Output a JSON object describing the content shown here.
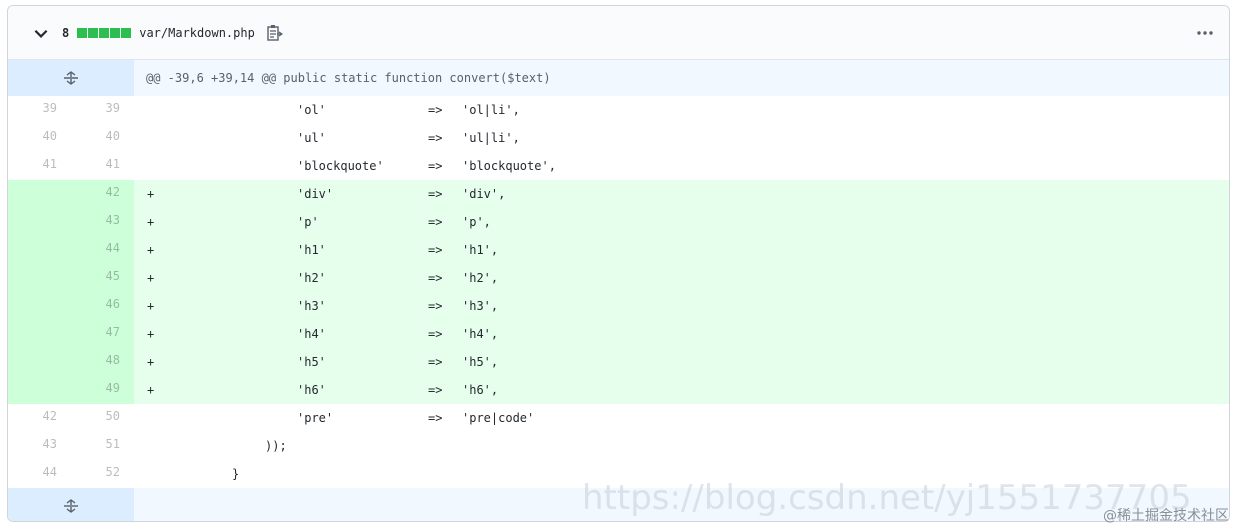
{
  "file": {
    "changes": "8",
    "path": "var/Markdown.php",
    "diffstat_color": "#2cbe4e",
    "icons": {
      "collapse": "chevron-down-icon",
      "copy": "copy-icon",
      "more": "kebab-horizontal-icon",
      "expand": "unfold-icon"
    }
  },
  "hunk": {
    "header": "@@ -39,6 +39,14 @@ public static function convert($text)"
  },
  "lines": [
    {
      "type": "context",
      "old": "39",
      "new": "39",
      "sign": "",
      "c1": "'ol'",
      "c2": "=>",
      "c3": "'ol|li',"
    },
    {
      "type": "context",
      "old": "40",
      "new": "40",
      "sign": "",
      "c1": "'ul'",
      "c2": "=>",
      "c3": "'ul|li',"
    },
    {
      "type": "context",
      "old": "41",
      "new": "41",
      "sign": "",
      "c1": "'blockquote'",
      "c2": "=>",
      "c3": "'blockquote',"
    },
    {
      "type": "addition",
      "old": "",
      "new": "42",
      "sign": "+",
      "c1": "'div'",
      "c2": "=>",
      "c3": "'div',"
    },
    {
      "type": "addition",
      "old": "",
      "new": "43",
      "sign": "+",
      "c1": "'p'",
      "c2": "=>",
      "c3": "'p',"
    },
    {
      "type": "addition",
      "old": "",
      "new": "44",
      "sign": "+",
      "c1": "'h1'",
      "c2": "=>",
      "c3": "'h1',"
    },
    {
      "type": "addition",
      "old": "",
      "new": "45",
      "sign": "+",
      "c1": "'h2'",
      "c2": "=>",
      "c3": "'h2',"
    },
    {
      "type": "addition",
      "old": "",
      "new": "46",
      "sign": "+",
      "c1": "'h3'",
      "c2": "=>",
      "c3": "'h3',"
    },
    {
      "type": "addition",
      "old": "",
      "new": "47",
      "sign": "+",
      "c1": "'h4'",
      "c2": "=>",
      "c3": "'h4',"
    },
    {
      "type": "addition",
      "old": "",
      "new": "48",
      "sign": "+",
      "c1": "'h5'",
      "c2": "=>",
      "c3": "'h5',"
    },
    {
      "type": "addition",
      "old": "",
      "new": "49",
      "sign": "+",
      "c1": "'h6'",
      "c2": "=>",
      "c3": "'h6',"
    },
    {
      "type": "context",
      "old": "42",
      "new": "50",
      "sign": "",
      "c1": "'pre'",
      "c2": "=>",
      "c3": "'pre|code'"
    },
    {
      "type": "context-2",
      "old": "43",
      "new": "51",
      "sign": "",
      "c1": "));",
      "c2": "",
      "c3": ""
    },
    {
      "type": "context-3",
      "old": "44",
      "new": "52",
      "sign": "",
      "c1": "}",
      "c2": "",
      "c3": ""
    }
  ],
  "watermark": {
    "url": "https://blog.csdn.net/yj1551737705",
    "site": "@稀土掘金技术社区"
  }
}
